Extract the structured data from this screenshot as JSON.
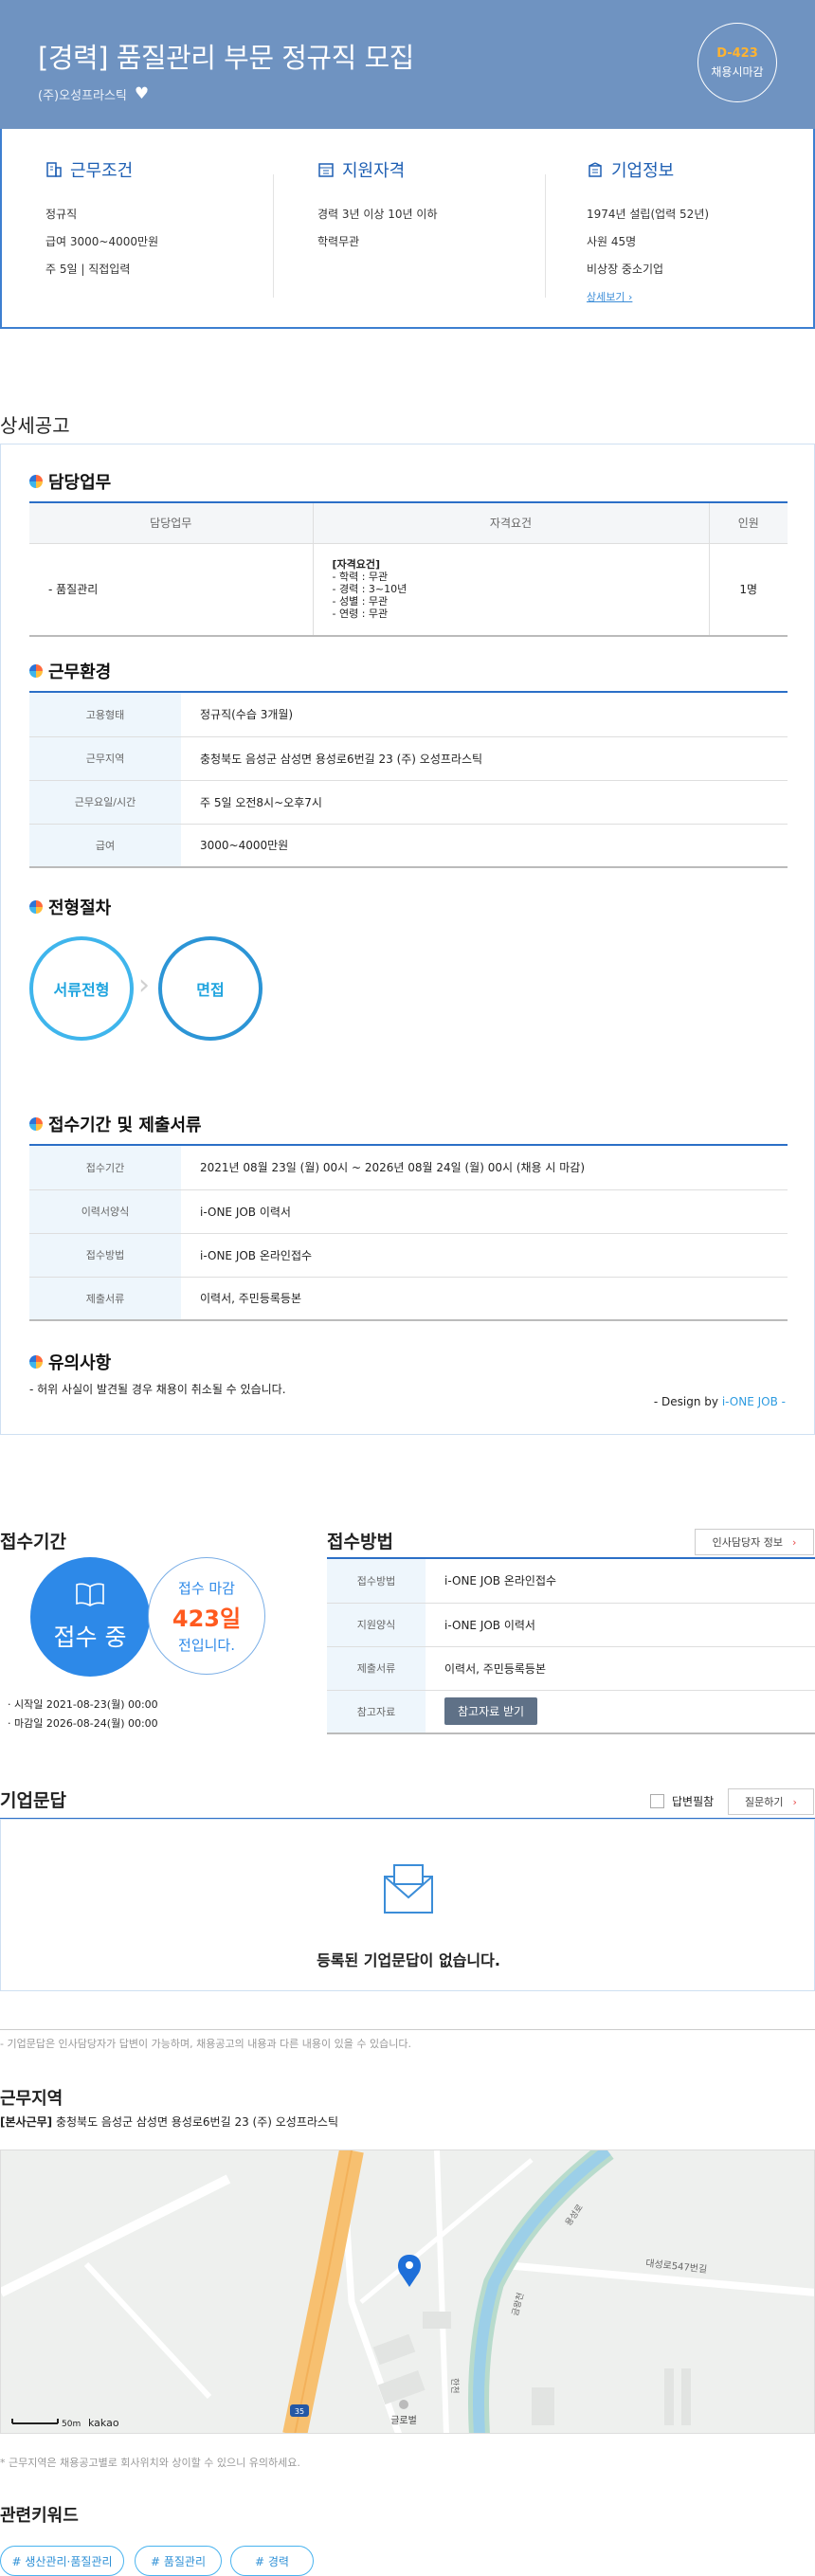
{
  "header": {
    "title": "[경력] 품질관리 부문 정규직 모집",
    "company": "(주)오성프라스틱",
    "dday": "D-423",
    "dday_label": "채용시마감"
  },
  "summary": {
    "work": {
      "title": "근무조건",
      "lines": [
        "정규직",
        "급여 3000~4000만원",
        "주 5일 | 직접입력"
      ]
    },
    "qual": {
      "title": "지원자격",
      "lines": [
        "경력 3년 이상 10년 이하",
        "학력무관"
      ]
    },
    "company": {
      "title": "기업정보",
      "lines": [
        "1974년 설립(업력 52년)",
        "사원 45명",
        "비상장 중소기업"
      ],
      "more": "상세보기 ›"
    }
  },
  "detail": {
    "section_title": "상세공고",
    "duty": {
      "title": "담당업무",
      "headers": [
        "담당업무",
        "자격요건",
        "인원"
      ],
      "row": {
        "duty": "- 품질관리",
        "req_title": "[자격요건]",
        "req_lines": [
          "- 학력 : 무관",
          "- 경력 : 3~10년",
          "- 성별 : 무관",
          "- 연령 : 무관"
        ],
        "count": "1명"
      }
    },
    "env": {
      "title": "근무환경",
      "rows": [
        {
          "k": "고용형태",
          "v": "정규직(수습 3개월)"
        },
        {
          "k": "근무지역",
          "v": "충청북도 음성군 삼성면 용성로6번길 23 (주) 오성프라스틱"
        },
        {
          "k": "근무요일/시간",
          "v": "주 5일 오전8시~오후7시"
        },
        {
          "k": "급여",
          "v": "3000~4000만원"
        }
      ]
    },
    "process": {
      "title": "전형절차",
      "steps": [
        "서류전형",
        "면접"
      ]
    },
    "period": {
      "title": "접수기간 및 제출서류",
      "rows": [
        {
          "k": "접수기간",
          "v": "2021년 08월 23일 (월) 00시 ~ 2026년 08월 24일 (월) 00시 (채용 시 마감)"
        },
        {
          "k": "이력서양식",
          "v": "i-ONE JOB 이력서"
        },
        {
          "k": "접수방법",
          "v": "i-ONE JOB 온라인접수"
        },
        {
          "k": "제출서류",
          "v": "이력서, 주민등록등본"
        }
      ]
    },
    "notice": {
      "title": "유의사항",
      "text": "- 허위 사실이 발견될 경우 채용이 취소될 수 있습니다.",
      "design_prefix": "- Design by ",
      "design_brand": "i-ONE JOB -"
    }
  },
  "apply": {
    "period_title": "접수기간",
    "status": "접수 중",
    "dday_top": "접수 마감",
    "dday_days": "423일",
    "dday_bottom": "전입니다.",
    "start": "· 시작일 2021-08-23(월) 00:00",
    "end": "· 마감일 2026-08-24(월) 00:00",
    "method_title": "접수방법",
    "hr_button": "인사담당자 정보",
    "rows": [
      {
        "k": "접수방법",
        "v": "i-ONE JOB 온라인접수"
      },
      {
        "k": "지원양식",
        "v": "i-ONE JOB 이력서"
      },
      {
        "k": "제출서류",
        "v": "이력서, 주민등록등본"
      },
      {
        "k": "참고자료",
        "v": ""
      }
    ],
    "ref_button": "참고자료 받기"
  },
  "qa": {
    "title": "기업문답",
    "answered": "답변필참",
    "ask_button": "질문하기",
    "empty": "등록된 기업문답이 없습니다.",
    "note": "- 기업문답은 인사담당자가 답변이 가능하며, 채용공고의 내용과 다른 내용이 있을 수 있습니다."
  },
  "location": {
    "title": "근무지역",
    "tag": "[본사근무]",
    "address": " 충청북도 음성군 삼성면 용성로6번길 23 (주) 오성프라스틱",
    "map": {
      "scale": "50m",
      "provider": "kakao",
      "road1": "대성로547번길",
      "road2": "용성로",
      "road3": "금왕천",
      "road4": "한천",
      "route": "35",
      "poi": "글로벌\n위제자재"
    },
    "note": "* 근무지역은 채용공고별로 회사위치와 상이할 수 있으니 유의하세요."
  },
  "keywords": {
    "title": "관련키워드",
    "items": [
      "# 생산관리·품질관리",
      "# 품질관리",
      "# 경력"
    ]
  }
}
